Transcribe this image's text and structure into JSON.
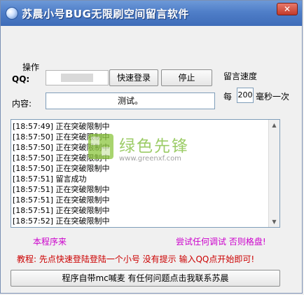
{
  "window": {
    "title": "苏晨小号BUG无限刷空间留言软件",
    "close_label": "✕"
  },
  "ops": {
    "group_label": "操作",
    "qq_label": "QQ:",
    "qq_value": "",
    "login_button": "快速登录",
    "stop_button": "停止",
    "content_label": "内容:",
    "content_value": "测试。"
  },
  "speed": {
    "label": "留言速度",
    "prefix": "每",
    "value": "200",
    "suffix": "毫秒一次"
  },
  "log": {
    "lines": [
      "[18:57:49] 正在突破限制中",
      "[18:57:50] 正在突破限制中",
      "[18:57:50] 正在突破限制中",
      "[18:57:50] 正在突破限制中",
      "[18:57:50] 正在突破限制中",
      "[18:57:51] 留言成功",
      "[18:57:51] 正在突破限制中",
      "[18:57:51] 正在突破限制中",
      "[18:57:51] 正在突破限制中",
      "[18:57:52] 正在突破限制中"
    ]
  },
  "watermark": {
    "brand": "绿色先锋",
    "url": "www.greenxf.com"
  },
  "notices": {
    "line1_start": "本程序来",
    "line1_end": "尝试任何调试 否则格盘!",
    "line2": "教程: 先点快速登陆登陆一个小号 没有提示 输入QQ点开始即可!",
    "colors": {
      "line1": "#cc00cc",
      "line2": "#cc0000"
    }
  },
  "footer": {
    "button_label": "程序自带mc喊麦 有任何问题点击我联系苏晨"
  }
}
